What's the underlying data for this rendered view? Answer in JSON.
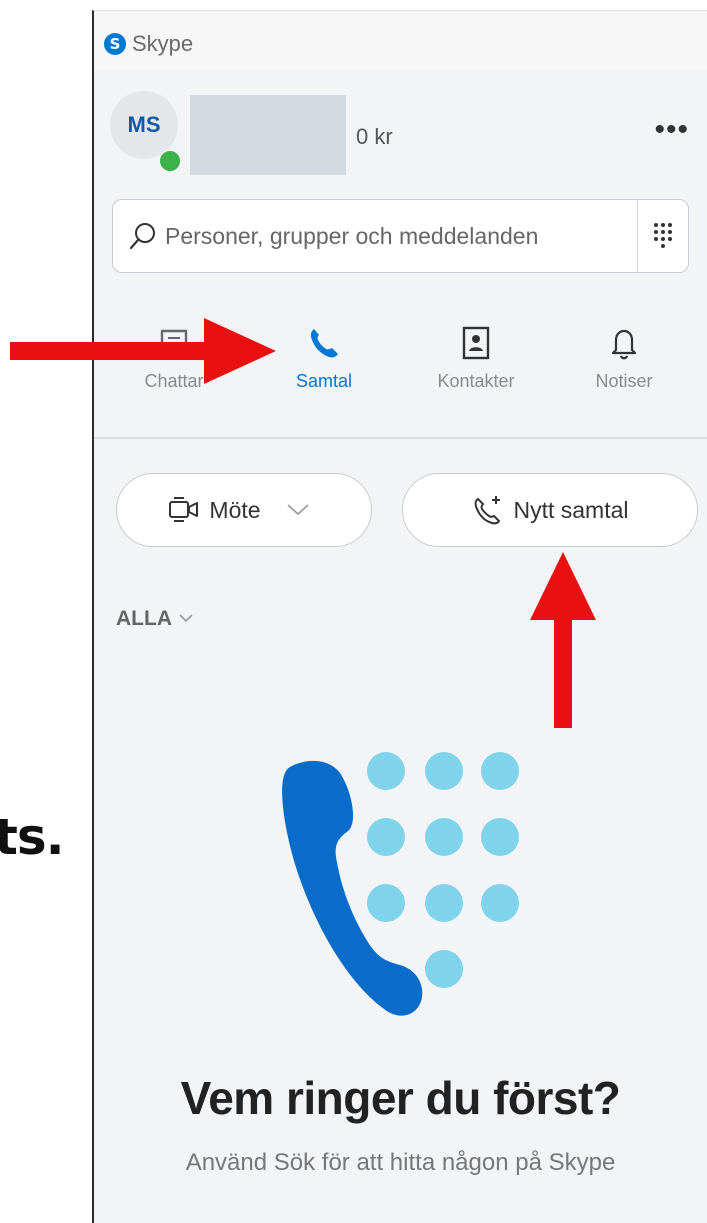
{
  "window": {
    "app_title": "Skype"
  },
  "profile": {
    "initials": "MS",
    "credit": "0 kr"
  },
  "search": {
    "placeholder": "Personer, grupper och meddelanden"
  },
  "tabs": [
    {
      "label": "Chattar"
    },
    {
      "label": "Samtal"
    },
    {
      "label": "Kontakter"
    },
    {
      "label": "Notiser"
    }
  ],
  "actions": {
    "meeting_label": "Möte",
    "new_call_label": "Nytt samtal"
  },
  "filter": {
    "label": "ALLA"
  },
  "empty_state": {
    "headline": "Vem ringer du först?",
    "subtext": "Använd Sök för att hitta någon på Skype"
  },
  "overlay": {
    "text": "ts."
  },
  "colors": {
    "accent": "#0078d4",
    "arrow": "#e81010",
    "presence": "#3bb34a",
    "dots": "#7fd3ea"
  }
}
